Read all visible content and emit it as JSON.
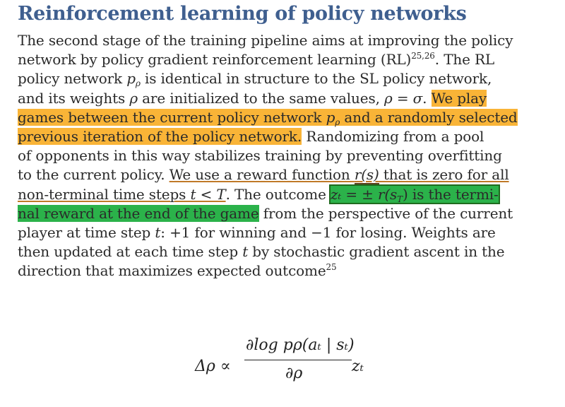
{
  "heading": "Reinforcement learning of policy networks",
  "lines": {
    "l1": "The second stage of the training pipeline aims at improving the policy",
    "l2a": "network by policy gradient reinforcement learning (RL)",
    "l2sup": "25,26",
    "l2b": ". The RL",
    "l3a": "policy network ",
    "l3p": "p",
    "l3psub": "ρ",
    "l3b": " is identical in structure to the SL policy network,",
    "l4a": "and its weights ",
    "l4rho": "ρ",
    "l4b": " are initialized to the same values, ",
    "l4eq": "ρ = σ",
    "l4c": ". ",
    "l4hl": "We play",
    "l5hl_a": "games between the current policy network ",
    "l5p": "p",
    "l5psub": "ρ",
    "l5hl_b": " and a randomly selected",
    "l6hl": "previous iteration of the policy network.",
    "l6b": " Randomizing from a pool",
    "l7": "of opponents in this way stabilizes training by preventing overfitting",
    "l8a": "to the current policy. ",
    "l8ul": "We use a reward function ",
    "l8r": "r(s)",
    "l8ul2": " that is zero for all",
    "l9ul": "non-terminal time steps ",
    "l9t": "t < T",
    "l9b": ". The outcome ",
    "l9g": "zₜ = ± r(s",
    "l9gsub": "T",
    "l9g2": ") is the termi-",
    "l10g": "nal reward at the end of the game",
    "l10b": " from the perspective of the current",
    "l11a": "player at time step ",
    "l11t": "t",
    "l11b": ": +1 for winning and −1 for losing. Weights are",
    "l12a": "then updated at each time step ",
    "l12t": "t",
    "l12b": " by stochastic gradient ascent in the",
    "l13": "direction that maximizes expected outcome",
    "l13sup": "25"
  },
  "equation": {
    "lhs": "Δρ ∝",
    "numerator": "∂log pρ(aₜ | sₜ)",
    "denominator": "∂ρ",
    "rhs": "zₜ"
  },
  "colors": {
    "heading": "#3f5f8f",
    "highlight_orange": "#f9b437",
    "highlight_green": "#2bb24a"
  }
}
